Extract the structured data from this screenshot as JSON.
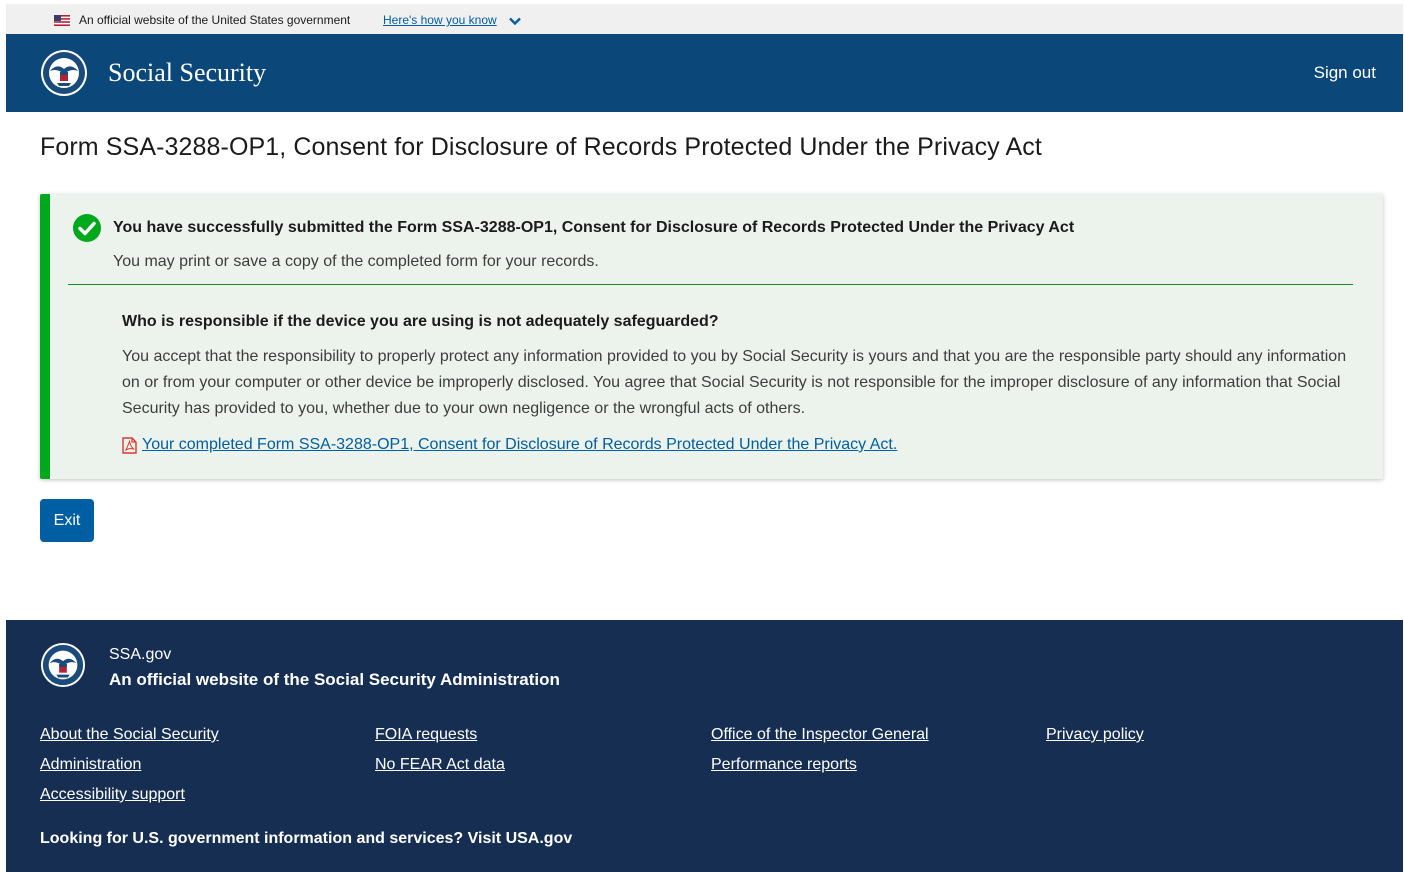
{
  "gov_banner": {
    "text": "An official website of the United States government",
    "link": "Here's how you know",
    "flag_icon": "us-flag-icon",
    "chevron_icon": "chevron-down-icon"
  },
  "header": {
    "brand": "Social Security",
    "sign_out": "Sign out",
    "seal_icon": "ssa-seal-icon"
  },
  "page_title": "Form SSA-3288-OP1, Consent for Disclosure of Records Protected Under the Privacy Act",
  "alert": {
    "status_icon": "check-circle-icon",
    "heading": "You have successfully submitted the Form SSA-3288-OP1, Consent for Disclosure of Records Protected Under the Privacy Act",
    "subtext": "You may print or save a copy of the completed form for your records.",
    "question": "Who is responsible if the device you are using is not adequately safeguarded?",
    "body": "You accept that the responsibility to properly protect any information provided to you by Social Security is yours and that you are the responsible party should any information on or from your computer or other device be improperly disclosed. You agree that Social Security is not responsible for the improper disclosure of any information that Social Security has provided to you, whether due to your own negligence or the wrongful acts of others.",
    "pdf_icon": "pdf-icon",
    "pdf_link": "Your completed Form SSA-3288-OP1, Consent for Disclosure of Records Protected Under the Privacy Act."
  },
  "exit_label": "Exit",
  "footer": {
    "site": "SSA.gov",
    "official": "An official website of the Social Security Administration",
    "links": {
      "about_1": "About the Social Security",
      "about_2": "Administration",
      "accessibility": "Accessibility support",
      "foia": "FOIA requests",
      "no_fear": "No FEAR Act data",
      "oig": "Office of the Inspector General",
      "performance": "Performance reports",
      "privacy": "Privacy policy"
    },
    "usagov_text": "Looking for U.S. government information and services?",
    "usagov_link": "Visit USA.gov"
  },
  "colors": {
    "header_bg": "#0b4778",
    "footer_bg": "#162e51",
    "success": "#00a91c",
    "alert_bg": "#ecf3ec",
    "primary": "#005ea2",
    "pdf_red": "#d83933"
  }
}
